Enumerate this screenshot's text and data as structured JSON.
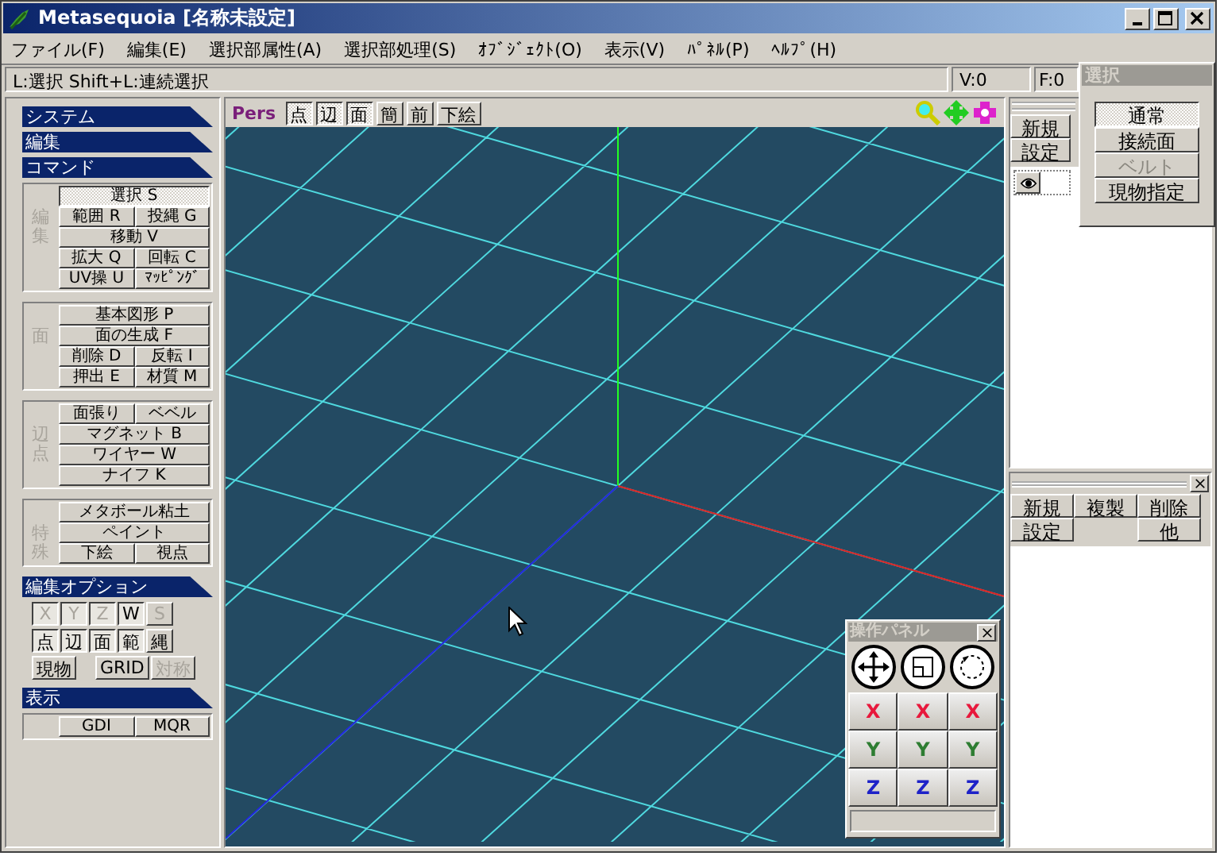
{
  "window": {
    "title": "Metasequoia [名称未設定]"
  },
  "menu": [
    "ファイル(F)",
    "編集(E)",
    "選択部属性(A)",
    "選択部処理(S)",
    "ｵﾌﾞｼﾞｪｸﾄ(O)",
    "表示(V)",
    "ﾊﾟﾈﾙ(P)",
    "ﾍﾙﾌﾟ(H)"
  ],
  "status_bar": {
    "hint": "L:選択  Shift+L:連続選択",
    "vertex_count": "V:0",
    "face_count": "F:0"
  },
  "left_panel": {
    "collapsed_sections": [
      "システム",
      "編集"
    ],
    "command": {
      "title": "コマンド",
      "groups": [
        {
          "label": "編集",
          "rows": [
            [
              {
                "label": "選択 S",
                "selected": true
              }
            ],
            [
              {
                "label": "範囲 R",
                "selected": false
              },
              {
                "label": "投縄 G",
                "selected": false
              }
            ],
            [
              {
                "label": "移動 V",
                "selected": false
              }
            ],
            [
              {
                "label": "拡大 Q",
                "selected": false
              },
              {
                "label": "回転 C",
                "selected": false
              }
            ],
            [
              {
                "label": "UV操 U",
                "selected": false
              },
              {
                "label": "ﾏｯﾋﾟﾝｸﾞ",
                "selected": false
              }
            ]
          ]
        },
        {
          "label": "面",
          "rows": [
            [
              {
                "label": "基本図形 P",
                "selected": false
              }
            ],
            [
              {
                "label": "面の生成 F",
                "selected": false
              }
            ],
            [
              {
                "label": "削除 D",
                "selected": false
              },
              {
                "label": "反転 I",
                "selected": false
              }
            ],
            [
              {
                "label": "押出 E",
                "selected": false
              },
              {
                "label": "材質 M",
                "selected": false
              }
            ]
          ]
        },
        {
          "label": "辺点",
          "rows": [
            [
              {
                "label": "面張り",
                "selected": false
              },
              {
                "label": "ベベル",
                "selected": false
              }
            ],
            [
              {
                "label": "マグネット B",
                "selected": false
              }
            ],
            [
              {
                "label": "ワイヤー W",
                "selected": false
              }
            ],
            [
              {
                "label": "ナイフ K",
                "selected": false
              }
            ]
          ]
        },
        {
          "label": "特殊",
          "rows": [
            [
              {
                "label": "メタボール粘土",
                "selected": false
              }
            ],
            [
              {
                "label": "ペイント",
                "selected": false
              }
            ],
            [
              {
                "label": "下絵",
                "selected": false
              },
              {
                "label": "視点",
                "selected": false
              }
            ]
          ]
        }
      ]
    },
    "edit_options": {
      "title": "編集オプション",
      "axis_toggles": [
        {
          "label": "X",
          "on": true,
          "disabled": true
        },
        {
          "label": "Y",
          "on": true,
          "disabled": true
        },
        {
          "label": "Z",
          "on": true,
          "disabled": true
        },
        {
          "label": "W",
          "on": true,
          "disabled": false
        },
        {
          "label": "S",
          "on": false,
          "disabled": true
        }
      ],
      "target_toggles": [
        {
          "label": "点",
          "on": true,
          "disabled": false
        },
        {
          "label": "辺",
          "on": true,
          "disabled": false
        },
        {
          "label": "面",
          "on": true,
          "disabled": false
        },
        {
          "label": "範",
          "on": true,
          "disabled": false
        },
        {
          "label": "縄",
          "on": false,
          "disabled": false
        }
      ],
      "extra_toggles": [
        {
          "label": "現物",
          "on": false,
          "disabled": false
        },
        {
          "label": "GRID",
          "on": false,
          "disabled": false
        },
        {
          "label": "対称",
          "on": false,
          "disabled": true
        }
      ]
    },
    "display": {
      "title": "表示",
      "rows": [
        [
          {
            "label": "GDI",
            "selected": false
          },
          {
            "label": "MQR",
            "selected": false
          }
        ]
      ]
    }
  },
  "viewport": {
    "view_label": "Pers",
    "toggles": [
      {
        "label": "点",
        "selected": true
      },
      {
        "label": "辺",
        "selected": true
      },
      {
        "label": "面",
        "selected": true
      },
      {
        "label": "簡",
        "selected": false
      },
      {
        "label": "前",
        "selected": false
      },
      {
        "label": "下絵",
        "selected": false
      }
    ]
  },
  "object_panel": {
    "buttons": [
      "新規",
      "設定"
    ],
    "objects": [
      {
        "visible": true
      }
    ]
  },
  "select_panel": {
    "title": "選択",
    "options": [
      {
        "label": "通常",
        "selected": true,
        "disabled": false
      },
      {
        "label": "接続面",
        "selected": false,
        "disabled": false
      },
      {
        "label": "ベルト",
        "selected": false,
        "disabled": true
      },
      {
        "label": "現物指定",
        "selected": false,
        "disabled": false
      }
    ]
  },
  "material_panel": {
    "rows": [
      [
        "新規",
        "複製",
        "削除"
      ],
      [
        "設定",
        null,
        "他"
      ]
    ]
  },
  "operation_panel": {
    "title": "操作パネル",
    "axis_rows": [
      {
        "labels": [
          "X",
          "X",
          "X"
        ],
        "color": "#e8183c"
      },
      {
        "labels": [
          "Y",
          "Y",
          "Y"
        ],
        "color": "#2e7d32"
      },
      {
        "labels": [
          "Z",
          "Z",
          "Z"
        ],
        "color": "#1e22c8"
      }
    ]
  }
}
